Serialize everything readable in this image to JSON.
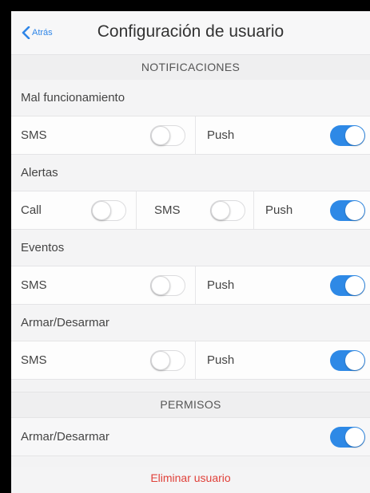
{
  "colors": {
    "accent": "#2e89e6",
    "danger": "#e0413a"
  },
  "header": {
    "back_label": "Atrás",
    "back_icon": "chevron-left-icon",
    "title": "Configuración de usuario"
  },
  "notifications": {
    "section_title": "NOTIFICACIONES",
    "malfunction": {
      "label": "Mal funcionamiento",
      "sms": {
        "label": "SMS",
        "enabled": false
      },
      "push": {
        "label": "Push",
        "enabled": true
      }
    },
    "alerts": {
      "label": "Alertas",
      "call": {
        "label": "Call",
        "enabled": false
      },
      "sms": {
        "label": "SMS",
        "enabled": false
      },
      "push": {
        "label": "Push",
        "enabled": true
      }
    },
    "events": {
      "label": "Eventos",
      "sms": {
        "label": "SMS",
        "enabled": false
      },
      "push": {
        "label": "Push",
        "enabled": true
      }
    },
    "arm_disarm": {
      "label": "Armar/Desarmar",
      "sms": {
        "label": "SMS",
        "enabled": false
      },
      "push": {
        "label": "Push",
        "enabled": true
      }
    }
  },
  "permissions": {
    "section_title": "PERMISOS",
    "arm_disarm": {
      "label": "Armar/Desarmar",
      "enabled": true
    }
  },
  "delete_user_label": "Eliminar usuario"
}
